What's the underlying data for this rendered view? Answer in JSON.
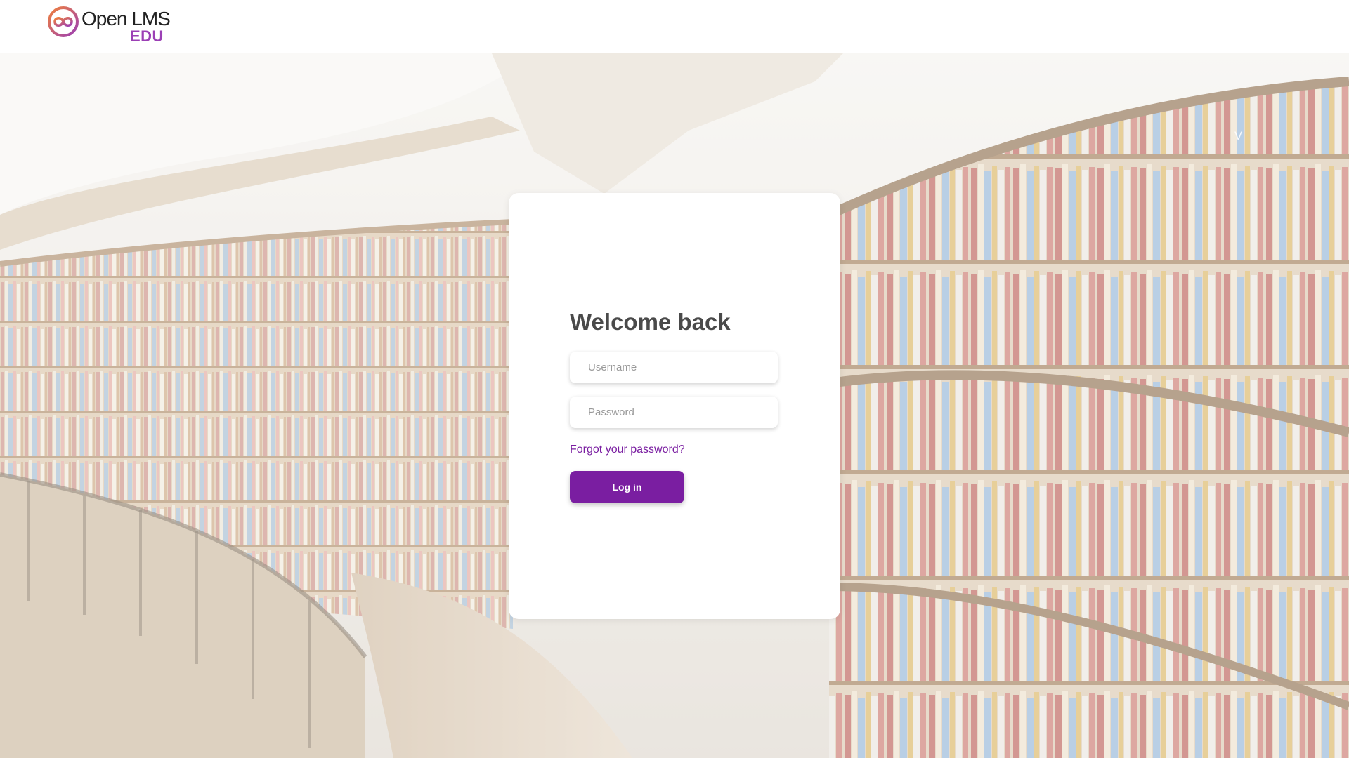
{
  "brand": {
    "name": "Open LMS",
    "sub": "EDU",
    "logo_icon": "infinity-loop-icon",
    "colors": {
      "accent": "#7a1ea1",
      "logo_orange": "#f0803c",
      "logo_purple": "#9b3fb5"
    }
  },
  "background": {
    "icon": "library-bookshelves-image",
    "corner_mark": "V"
  },
  "login": {
    "title": "Welcome back",
    "username_placeholder": "Username",
    "password_placeholder": "Password",
    "forgot_label": "Forgot your password?",
    "login_label": "Log in"
  }
}
